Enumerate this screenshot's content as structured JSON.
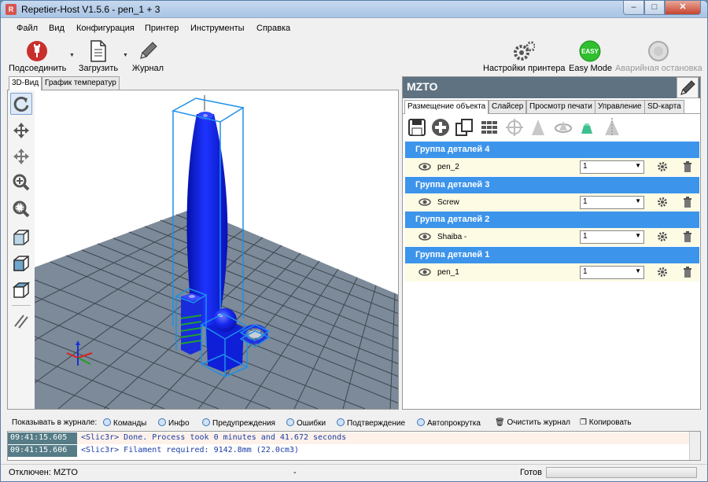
{
  "window": {
    "title": "Repetier-Host V1.5.6 - pen_1 + 3",
    "app_icon": "R",
    "min": "–",
    "max": "□",
    "close": "✕"
  },
  "menu": [
    "Файл",
    "Вид",
    "Конфигурация",
    "Принтер",
    "Инструменты",
    "Справка"
  ],
  "toolbar": {
    "connect": "Подсоединить",
    "load": "Загрузить",
    "log": "Журнал",
    "printer_settings": "Настройки принтера",
    "easy_mode": "Easy Mode",
    "easy_badge": "EASY",
    "emergency": "Аварийная остановка"
  },
  "view_tabs": [
    "3D-Вид",
    "График температур"
  ],
  "panel": {
    "printer_name": "MZTO",
    "tabs": [
      "Размещение объекта",
      "Слайсер",
      "Просмотр печати",
      "Управление",
      "SD-карта"
    ],
    "groups": [
      {
        "title": "Группа деталей 4",
        "object": "pen_2",
        "copies": "1"
      },
      {
        "title": "Группа деталей 3",
        "object": "Screw",
        "copies": "1"
      },
      {
        "title": "Группа деталей 2",
        "object": "Shaiba -",
        "copies": "1"
      },
      {
        "title": "Группа деталей 1",
        "object": "pen_1",
        "copies": "1"
      }
    ]
  },
  "logbar": {
    "label": "Показывать в журнале:",
    "commands": "Команды",
    "info": "Инфо",
    "warnings": "Предупреждения",
    "errors": "Ошибки",
    "ack": "Подтверждение",
    "autoscroll": "Автопрокрутка",
    "clear": "Очистить журнал",
    "copy": "Копировать"
  },
  "log": [
    {
      "time": "09:41:15.605",
      "text": "<Slic3r> Done. Process took 0 minutes and 41.672 seconds"
    },
    {
      "time": "09:41:15.606",
      "text": "<Slic3r> Filament required: 9142.8mm (22.0cm3)"
    }
  ],
  "status": {
    "connection": "Отключен: MZTO",
    "middle": "-",
    "ready": "Готов"
  },
  "colors": {
    "group_header": "#3d94eb",
    "panel_head": "#5f7281",
    "model": "#0a1fd6",
    "bbox": "#1e8fe8",
    "bed": "#7c8a99"
  }
}
